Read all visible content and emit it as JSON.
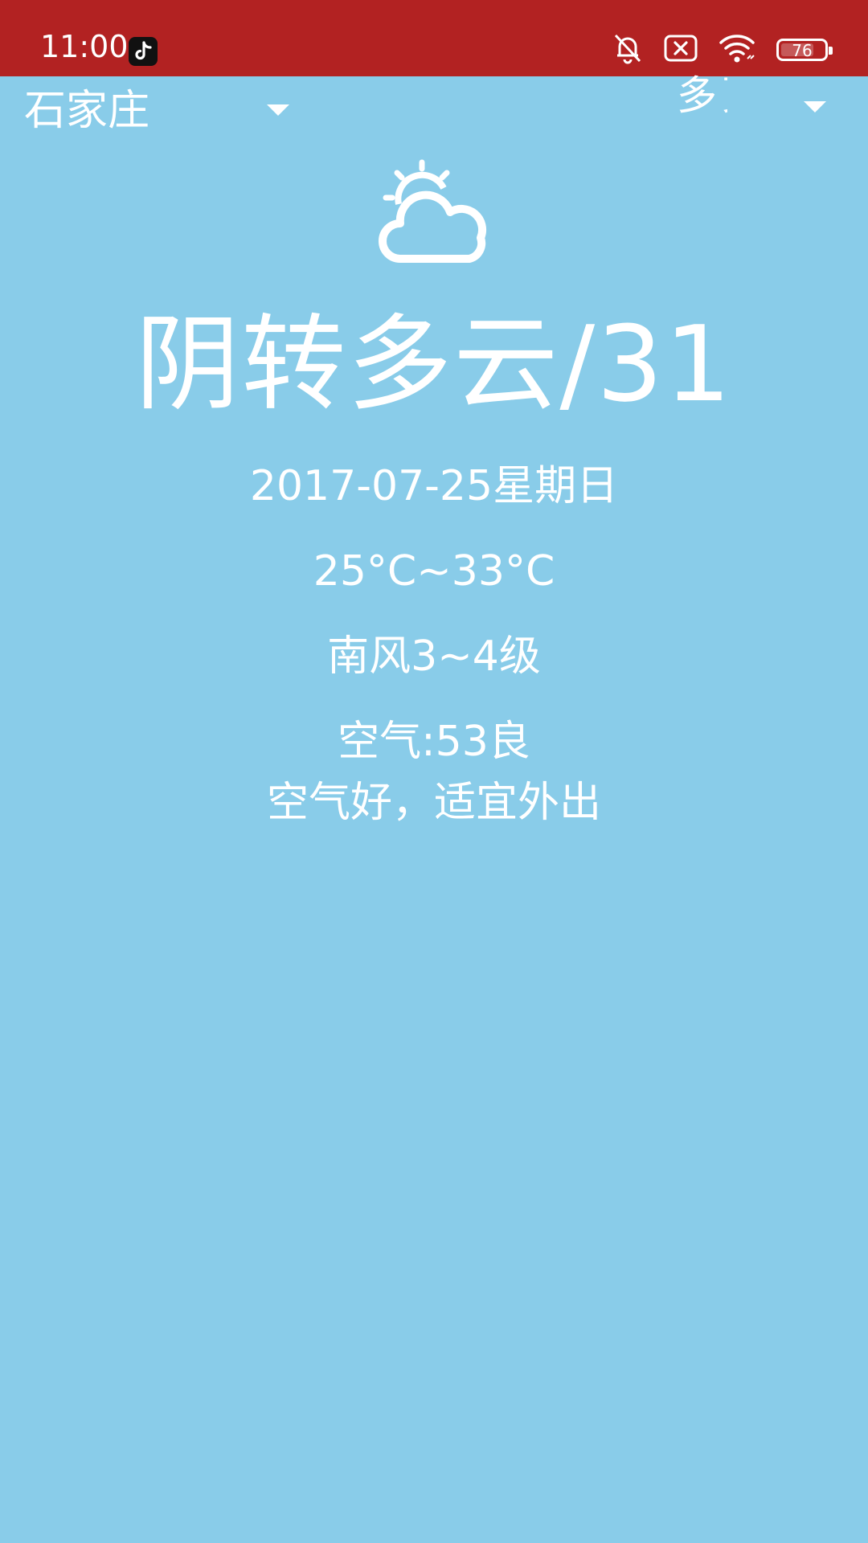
{
  "status_bar": {
    "time": "11:00",
    "battery": "76",
    "battery_level": 0.76,
    "icons": [
      "tiktok-icon",
      "bell-muted-icon",
      "sim-error-icon",
      "wifi-icon",
      "battery-icon"
    ]
  },
  "header": {
    "city": "石家庄",
    "more": "更多"
  },
  "weather": {
    "icon": "partly-cloudy-icon",
    "title": "阴转多云/31",
    "date": "2017-07-25星期日",
    "temperature_range": "25°C~33°C",
    "wind": "南风3~4级",
    "air": "空气:53良",
    "advice": "空气好，适宜外出"
  },
  "colors": {
    "status_bar": "#b22222",
    "background": "#89cce9",
    "text": "#ffffff"
  }
}
